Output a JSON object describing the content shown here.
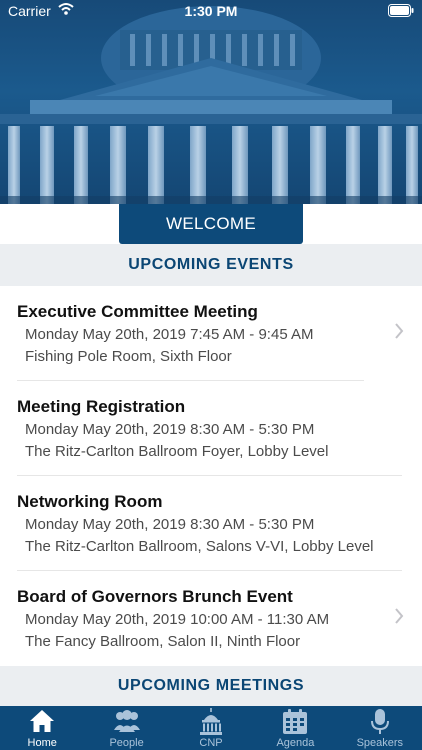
{
  "status_bar": {
    "carrier": "Carrier",
    "time": "1:30 PM"
  },
  "welcome": {
    "label": "WELCOME"
  },
  "sections": {
    "upcoming_events": "UPCOMING EVENTS",
    "upcoming_meetings": "UPCOMING MEETINGS"
  },
  "events": [
    {
      "title": "Executive Committee Meeting",
      "time": "Monday May 20th, 2019 7:45 AM - 9:45 AM",
      "location": "Fishing Pole Room, Sixth Floor"
    },
    {
      "title": "Meeting Registration",
      "time": "Monday May 20th, 2019 8:30 AM - 5:30 PM",
      "location": "The Ritz-Carlton Ballroom Foyer, Lobby Level"
    },
    {
      "title": "Networking Room",
      "time": "Monday May 20th, 2019 8:30 AM - 5:30 PM",
      "location": "The Ritz-Carlton Ballroom, Salons V-VI, Lobby Level"
    },
    {
      "title": "Board of Governors Brunch Event",
      "time": "Monday May 20th, 2019 10:00 AM - 11:30 AM",
      "location": "The Fancy Ballroom, Salon II, Ninth Floor"
    }
  ],
  "tabs": [
    {
      "label": "Home",
      "icon": "home-icon"
    },
    {
      "label": "People",
      "icon": "people-icon"
    },
    {
      "label": "CNP",
      "icon": "capitol-icon"
    },
    {
      "label": "Agenda",
      "icon": "calendar-icon"
    },
    {
      "label": "Speakers",
      "icon": "microphone-icon"
    }
  ],
  "colors": {
    "brand": "#0d4a7a",
    "section_bg": "#ebeef1",
    "tab_inactive": "#aac3da"
  }
}
